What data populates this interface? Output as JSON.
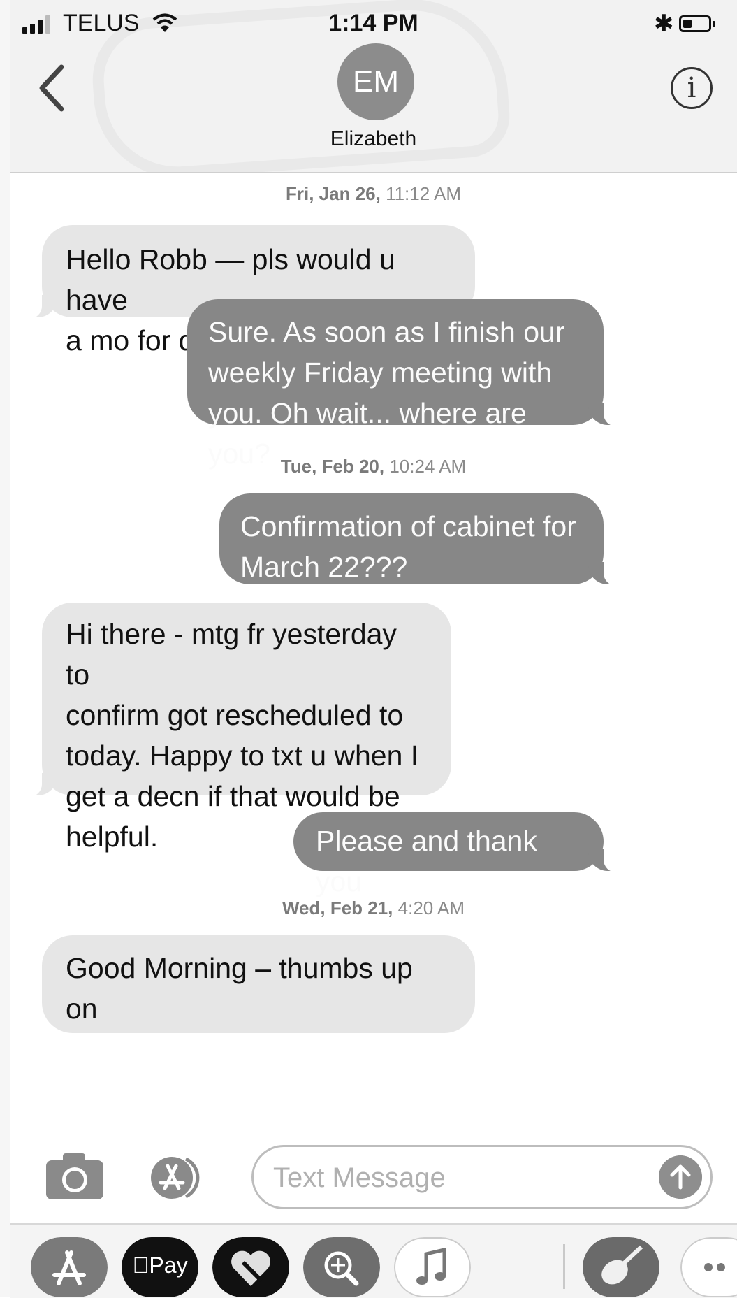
{
  "status_bar": {
    "carrier": "TELUS",
    "time": "1:14 PM",
    "battery_level": 0.35,
    "bluetooth_symbol": "✱"
  },
  "header": {
    "back_icon": "chevron-left-icon",
    "avatar_initials": "EM",
    "contact_name": "Elizabeth",
    "info_symbol": "i"
  },
  "timestamps": [
    {
      "day": "Fri, Jan 26,",
      "time": " 11:12 AM"
    },
    {
      "day": "Tue, Feb 20,",
      "time": " 10:24 AM"
    },
    {
      "day": "Wed, Feb 21,",
      "time": " 4:20 AM"
    }
  ],
  "messages": [
    {
      "direction": "in",
      "text": "Hello Robb — pls would u have\na mo for qk ph call this am?"
    },
    {
      "direction": "out",
      "text": "Sure. As soon as I finish our\nweekly Friday meeting with\nyou. Oh wait... where are you?"
    },
    {
      "direction": "out",
      "text": "Confirmation of cabinet for\nMarch 22???"
    },
    {
      "direction": "in",
      "text": "Hi there - mtg fr yesterday to\nconfirm got rescheduled to\ntoday.  Happy to txt u when I\nget a decn if that would be\nhelpful."
    },
    {
      "direction": "out",
      "text": "Please and thank you"
    },
    {
      "direction": "in",
      "text": "Good Morning – thumbs up on"
    }
  ],
  "compose": {
    "camera_icon": "camera-icon",
    "apps_icon": "app-store-icon",
    "placeholder": "Text Message",
    "send_icon": "arrow-up-icon"
  },
  "app_drawer": {
    "apps": [
      "app-store-icon",
      "apple-pay-icon",
      "digital-touch-heart-icon",
      "image-search-icon",
      "music-icon",
      "garageband-guitar-icon",
      "more-icon"
    ],
    "pay_label": "Pay"
  }
}
